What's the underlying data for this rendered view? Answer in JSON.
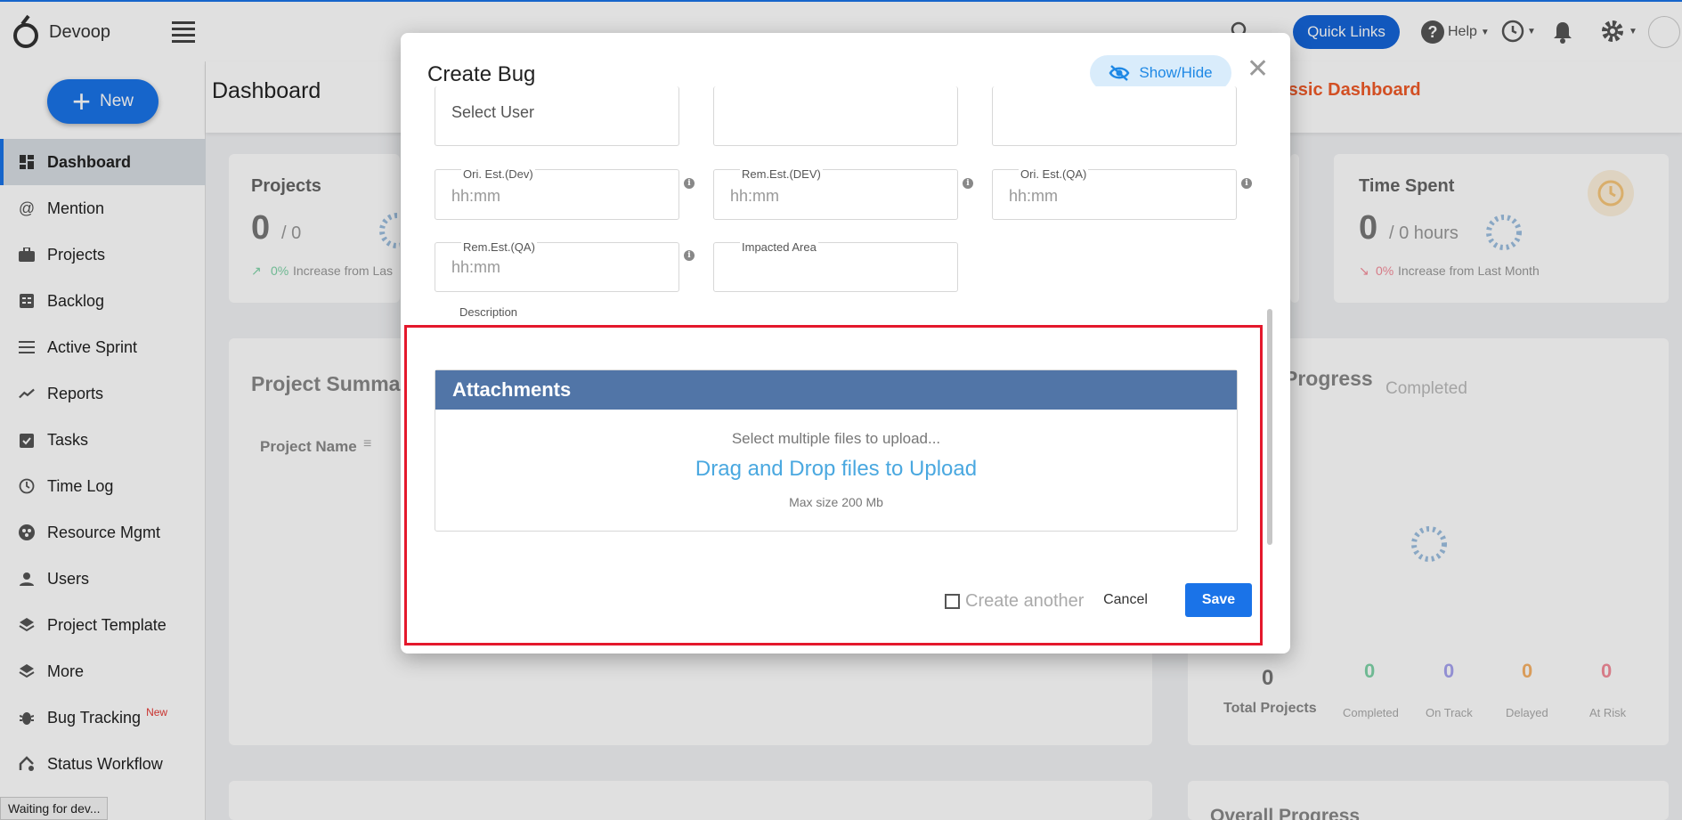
{
  "app": {
    "brand": "Devoop"
  },
  "topbar": {
    "quick_links": "Quick Links",
    "help": "Help"
  },
  "sidebar": {
    "new_label": "New",
    "items": [
      {
        "label": "Dashboard",
        "icon": "dashboard-icon",
        "active": true
      },
      {
        "label": "Mention",
        "icon": "at-icon"
      },
      {
        "label": "Projects",
        "icon": "briefcase-icon"
      },
      {
        "label": "Backlog",
        "icon": "backlog-icon"
      },
      {
        "label": "Active Sprint",
        "icon": "list-icon"
      },
      {
        "label": "Reports",
        "icon": "trend-icon"
      },
      {
        "label": "Tasks",
        "icon": "clipboard-check-icon"
      },
      {
        "label": "Time Log",
        "icon": "clock-icon"
      },
      {
        "label": "Resource Mgmt",
        "icon": "resource-icon"
      },
      {
        "label": "Users",
        "icon": "user-icon"
      },
      {
        "label": "Project Template",
        "icon": "layers-icon"
      },
      {
        "label": "More",
        "icon": "layers-icon"
      },
      {
        "label": "Bug Tracking",
        "icon": "bug-icon",
        "badge": "New"
      },
      {
        "label": "Status Workflow",
        "icon": "workflow-icon"
      }
    ]
  },
  "status_bar": "Waiting for dev...",
  "dashboard": {
    "title": "Dashboard",
    "classic_link": "lassic Dashboard",
    "projects_card": {
      "title": "Projects",
      "value": "0",
      "suffix": "/ 0",
      "trend_pct": "0%",
      "trend_text": "Increase from Las"
    },
    "time_spent_card": {
      "title": "Time Spent",
      "value": "0",
      "suffix": "/ 0 hours",
      "trend_pct": "0%",
      "trend_text": "Increase from Last Month"
    },
    "summary_title": "Project Summa",
    "project_name_col": "Project Name",
    "progress_title": "Progress",
    "completed_label": "Completed",
    "stats": [
      {
        "value": "0",
        "label": "Total Projects"
      },
      {
        "value": "0",
        "label": "Completed",
        "color": "#7fd3a8"
      },
      {
        "value": "0",
        "label": "On Track",
        "color": "#a7a3f0"
      },
      {
        "value": "0",
        "label": "Delayed",
        "color": "#f7b267"
      },
      {
        "value": "0",
        "label": "At Risk",
        "color": "#f48c9a"
      }
    ],
    "overall_progress": "Overall Progress"
  },
  "modal": {
    "title": "Create Bug",
    "show_hide": "Show/Hide",
    "select_user_placeholder": "Select User",
    "fields": {
      "ori_est_dev": {
        "label": "Ori. Est.(Dev)",
        "placeholder": "hh:mm"
      },
      "rem_est_dev": {
        "label": "Rem.Est.(DEV)",
        "placeholder": "hh:mm"
      },
      "ori_est_qa": {
        "label": "Ori. Est.(QA)",
        "placeholder": "hh:mm"
      },
      "rem_est_qa": {
        "label": "Rem.Est.(QA)",
        "placeholder": "hh:mm"
      },
      "impacted_area": {
        "label": "Impacted Area",
        "placeholder": ""
      }
    },
    "description_label": "Description",
    "attachments": {
      "title": "Attachments",
      "hint": "Select multiple files to upload...",
      "drop_text": "Drag and Drop files to Upload",
      "max_size": "Max size 200 Mb"
    },
    "create_another": "Create another",
    "cancel": "Cancel",
    "save": "Save"
  },
  "colors": {
    "primary": "#1a73e8",
    "attach_header": "#5175a7",
    "highlight": "#e4182c",
    "link": "#4aa8e0"
  }
}
